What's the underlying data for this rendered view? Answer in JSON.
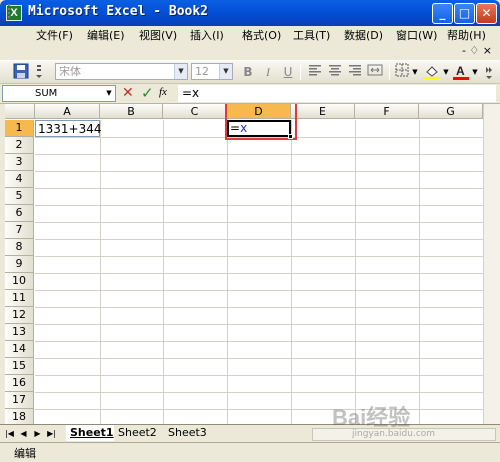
{
  "window": {
    "title": "Microsoft Excel - Book2",
    "app_icon": "X",
    "controls": {
      "minimize": "_",
      "maximize": "□",
      "close": "✕"
    }
  },
  "menu": {
    "items": [
      {
        "label": "文件(F)"
      },
      {
        "label": "编辑(E)"
      },
      {
        "label": "视图(V)"
      },
      {
        "label": "插入(I)"
      },
      {
        "label": "格式(O)"
      },
      {
        "label": "工具(T)"
      },
      {
        "label": "数据(D)"
      },
      {
        "label": "窗口(W)"
      },
      {
        "label": "帮助(H)"
      }
    ],
    "doc_controls": "-  ♢  ×"
  },
  "toolbar": {
    "font": "宋体",
    "font_size": "12",
    "bold": "B",
    "italic": "I",
    "underline": "U",
    "fill_color": "#ffff00",
    "font_color": "#ff0000"
  },
  "formula_bar": {
    "name_box": "SUM",
    "cancel": "✕",
    "enter": "✓",
    "fx": "fx",
    "content": "=x"
  },
  "sheet": {
    "columns": [
      "A",
      "B",
      "C",
      "D",
      "E",
      "F",
      "G"
    ],
    "rows": [
      "1",
      "2",
      "3",
      "4",
      "5",
      "6",
      "7",
      "8",
      "9",
      "10",
      "11",
      "12",
      "13",
      "14",
      "15",
      "16",
      "17",
      "18"
    ],
    "active_column": "D",
    "active_row": "1",
    "cells": {
      "A1": "1331+344",
      "D1_prefix": "=",
      "D1_ref": "x"
    }
  },
  "tabs": {
    "items": [
      {
        "label": "Sheet1"
      },
      {
        "label": "Sheet2"
      },
      {
        "label": "Sheet3"
      }
    ],
    "active": "Sheet1"
  },
  "status": {
    "mode": "编辑"
  },
  "watermark": {
    "logo": "Bai经验",
    "url": "jingyan.baidu.com"
  }
}
